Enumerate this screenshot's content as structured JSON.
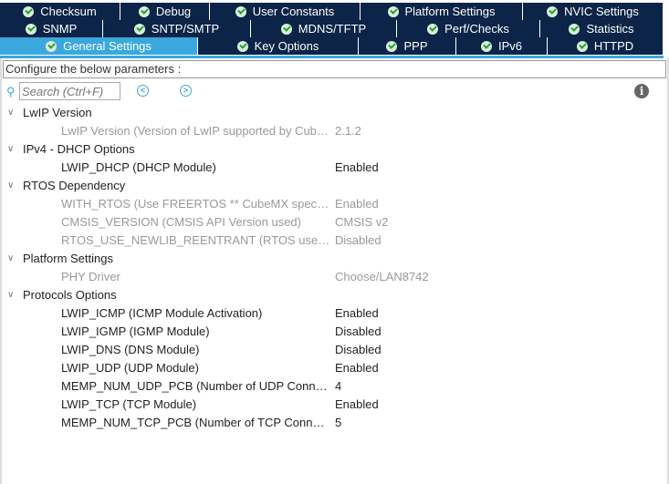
{
  "tabs": [
    [
      {
        "label": "Checksum"
      },
      {
        "label": "Debug"
      },
      {
        "label": "User Constants"
      },
      {
        "label": "Platform Settings"
      },
      {
        "label": "NVIC Settings"
      }
    ],
    [
      {
        "label": "SNMP"
      },
      {
        "label": "SNTP/SMTP"
      },
      {
        "label": "MDNS/TFTP"
      },
      {
        "label": "Perf/Checks"
      },
      {
        "label": "Statistics"
      }
    ],
    [
      {
        "label": "General Settings",
        "selected": true
      },
      {
        "label": "Key Options"
      },
      {
        "label": "PPP"
      },
      {
        "label": "IPv6"
      },
      {
        "label": "HTTPD"
      }
    ]
  ],
  "config_label": "Configure the below parameters :",
  "search": {
    "placeholder": "Search (Ctrl+F)"
  },
  "groups": [
    {
      "label": "LwIP Version",
      "items": [
        {
          "label": "LwIP Version (Version of LwIP supported by CubeMX)",
          "value": "2.1.2",
          "disabled": true
        }
      ]
    },
    {
      "label": "IPv4 - DHCP Options",
      "items": [
        {
          "label": "LWIP_DHCP (DHCP Module)",
          "value": "Enabled",
          "disabled": false
        }
      ]
    },
    {
      "label": "RTOS Dependency",
      "items": [
        {
          "label": "WITH_RTOS (Use FREERTOS ** CubeMX specific)",
          "value": "Enabled",
          "disabled": true
        },
        {
          "label": "CMSIS_VERSION (CMSIS API Version used)",
          "value": "CMSIS v2",
          "disabled": true
        },
        {
          "label": "RTOS_USE_NEWLIB_REENTRANT (RTOS used with newlib)",
          "value": "Disabled",
          "disabled": true
        }
      ]
    },
    {
      "label": "Platform Settings",
      "items": [
        {
          "label": "PHY Driver",
          "value": "Choose/LAN8742",
          "disabled": true
        }
      ]
    },
    {
      "label": "Protocols Options",
      "items": [
        {
          "label": "LWIP_ICMP (ICMP Module Activation)",
          "value": "Enabled",
          "disabled": false
        },
        {
          "label": "LWIP_IGMP (IGMP Module)",
          "value": "Disabled",
          "disabled": false
        },
        {
          "label": "LWIP_DNS (DNS Module)",
          "value": "Disabled",
          "disabled": false
        },
        {
          "label": "LWIP_UDP (UDP Module)",
          "value": "Enabled",
          "disabled": false
        },
        {
          "label": "MEMP_NUM_UDP_PCB (Number of UDP Connections)",
          "value": "4",
          "disabled": false
        },
        {
          "label": "LWIP_TCP (TCP Module)",
          "value": "Enabled",
          "disabled": false
        },
        {
          "label": "MEMP_NUM_TCP_PCB (Number of TCP Connections)",
          "value": "5",
          "disabled": false
        }
      ]
    }
  ]
}
